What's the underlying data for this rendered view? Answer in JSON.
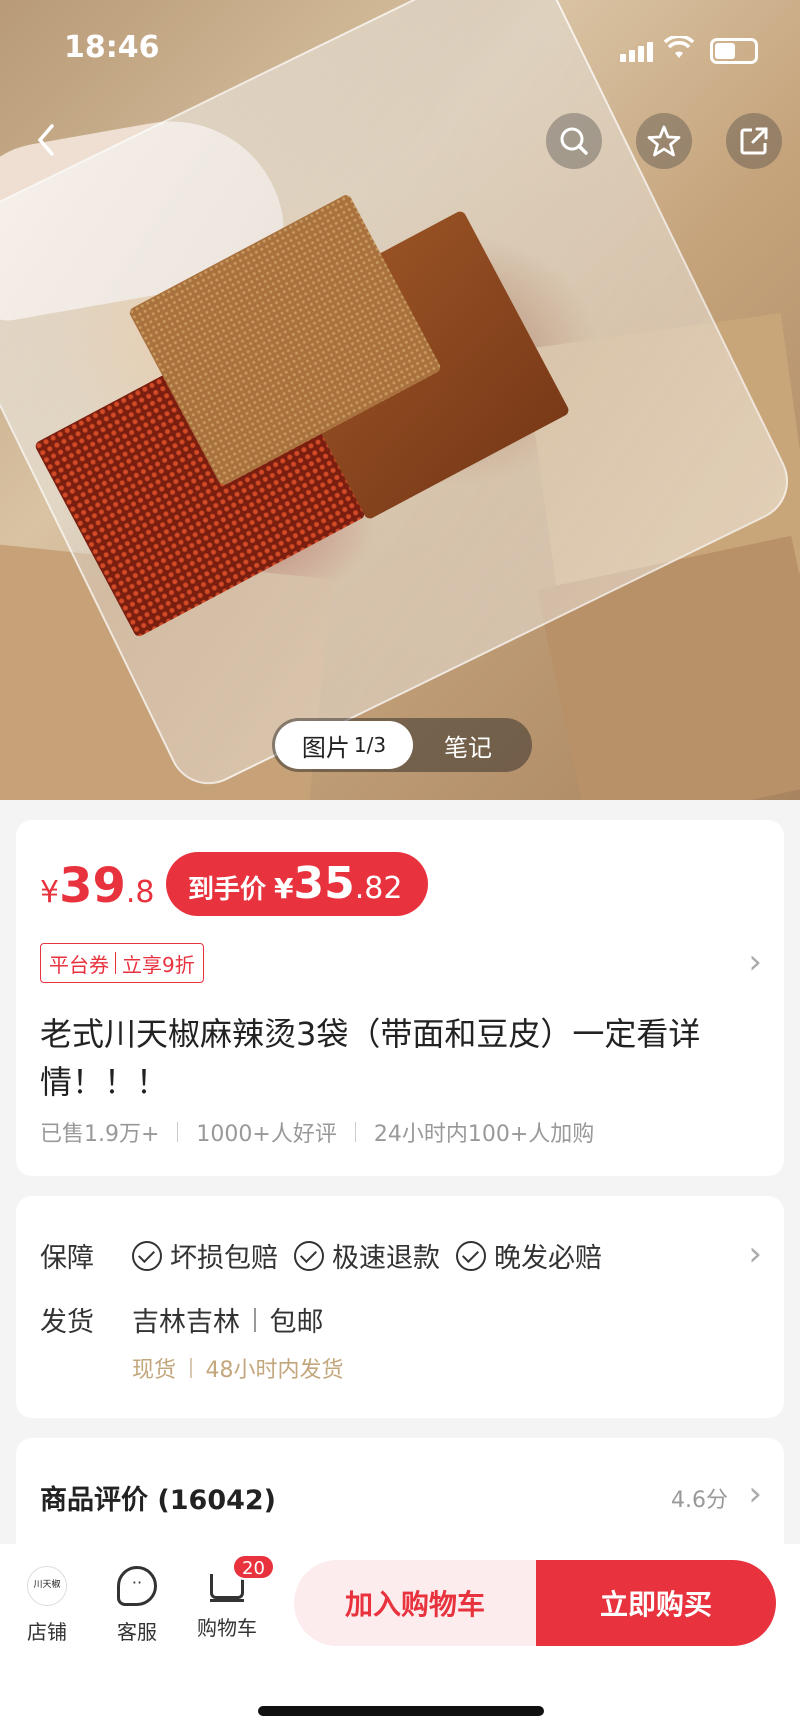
{
  "status_bar": {
    "time": "18:46"
  },
  "gallery": {
    "tab_photos": "图片",
    "tab_photos_index": "1/3",
    "tab_notes": "笔记"
  },
  "price": {
    "symbol": "¥",
    "integer": "39",
    "decimal": ".8",
    "promo_label": "到手价",
    "promo_symbol": "¥",
    "promo_integer": "35",
    "promo_decimal": ".82"
  },
  "coupon": {
    "left": "平台券",
    "right": "立享9折"
  },
  "product": {
    "title": "老式川天椒麻辣烫3袋（带面和豆皮）一定看详情！！！",
    "sold": "已售1.9万+",
    "good_reviews": "1000+人好评",
    "cart_adds": "24小时内100+人加购"
  },
  "guarantee": {
    "label": "保障",
    "items": [
      "坏损包赔",
      "极速退款",
      "晚发必赔"
    ]
  },
  "shipping": {
    "label": "发货",
    "origin": "吉林吉林",
    "fee": "包邮",
    "stock": "现货",
    "dispatch": "48小时内发货"
  },
  "reviews": {
    "title": "商品评价 (16042)",
    "score": "4.6分"
  },
  "bottom_bar": {
    "shop_label": "店铺",
    "shop_logo": "川天椒",
    "service_label": "客服",
    "cart_label": "购物车",
    "cart_count": "20",
    "add_to_cart": "加入购物车",
    "buy_now": "立即购买"
  },
  "colors": {
    "accent": "#e8333f",
    "shipping_note": "#c3a77c"
  }
}
